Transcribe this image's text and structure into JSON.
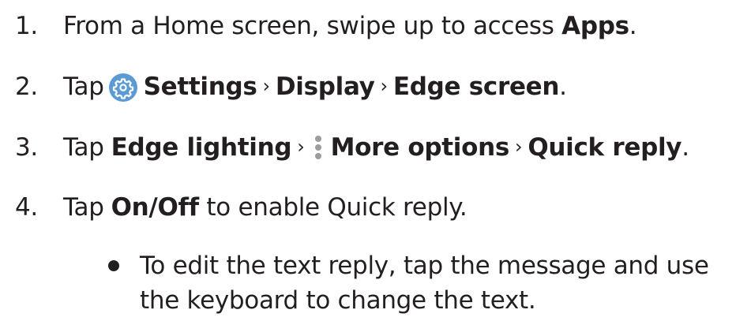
{
  "steps": [
    {
      "number": "1.",
      "text_before": "From a Home screen, swipe up to access ",
      "bold_apps": "Apps",
      "text_after": "."
    },
    {
      "number": "2.",
      "tap": "Tap",
      "settings": "Settings",
      "sep": "›",
      "display": "Display",
      "edge_screen": "Edge screen",
      "end": "."
    },
    {
      "number": "3.",
      "tap": "Tap",
      "edge_lighting": "Edge lighting",
      "sep": "›",
      "more_options": "More options",
      "quick_reply": "Quick reply",
      "end": "."
    },
    {
      "number": "4.",
      "tap": "Tap",
      "on_off": "On/Off",
      "rest": " to enable Quick reply."
    }
  ],
  "bullet": {
    "line1": "To edit the text reply, tap the message and use",
    "line2": "the keyboard to change the text."
  },
  "icons": {
    "settings_icon": "gear-icon",
    "more_options_icon": "vertical-dots-icon"
  },
  "colors": {
    "text": "#231f20",
    "settings_icon_bg": "#5b9bd5",
    "dots": "#9c9c9c"
  }
}
